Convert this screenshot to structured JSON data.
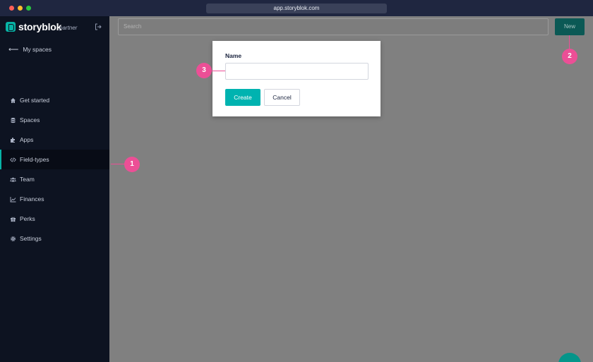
{
  "browser": {
    "url": "app.storyblok.com"
  },
  "sidebar": {
    "brand": "storyblok",
    "brand_sub": "partner",
    "back_link": "My spaces",
    "items": [
      {
        "label": "Get started",
        "icon": "home-icon"
      },
      {
        "label": "Spaces",
        "icon": "database-icon"
      },
      {
        "label": "Apps",
        "icon": "puzzle-icon"
      },
      {
        "label": "Field-types",
        "icon": "code-icon",
        "active": true
      },
      {
        "label": "Team",
        "icon": "users-icon"
      },
      {
        "label": "Finances",
        "icon": "chart-line-icon"
      },
      {
        "label": "Perks",
        "icon": "gift-icon"
      },
      {
        "label": "Settings",
        "icon": "gear-icon"
      }
    ]
  },
  "main": {
    "search_placeholder": "Search",
    "new_button": "New"
  },
  "modal": {
    "name_label": "Name",
    "name_value": "",
    "create_button": "Create",
    "cancel_button": "Cancel"
  },
  "annotations": {
    "callout_1": "1",
    "callout_2": "2",
    "callout_3": "3",
    "color": "#ec4f96"
  },
  "colors": {
    "accent": "#07b3a5",
    "sidebar_bg": "#0d1321",
    "overlay": "#808080",
    "primary_button": "#00b3b0"
  }
}
